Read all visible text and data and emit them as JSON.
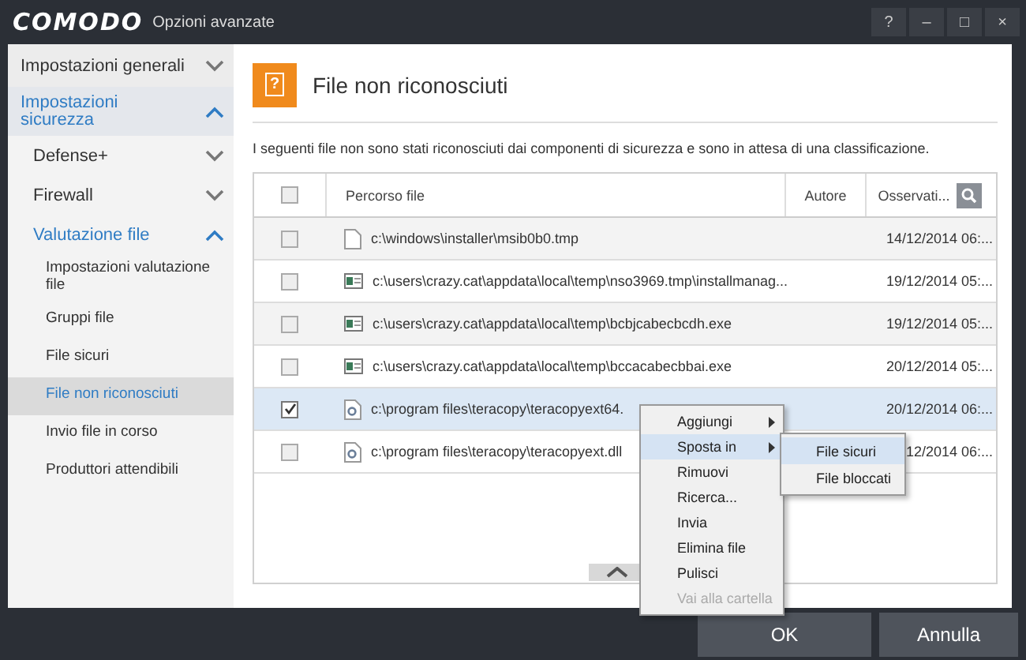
{
  "window": {
    "brand": "COMODO",
    "title": "Opzioni avanzate",
    "controls": [
      "?",
      "–",
      "□",
      "×"
    ]
  },
  "sidebar": {
    "items": [
      {
        "label": "Impostazioni generali",
        "expanded": false
      },
      {
        "label": "Impostazioni sicurezza",
        "expanded": true,
        "children": [
          {
            "label": "Defense+",
            "expanded": false
          },
          {
            "label": "Firewall",
            "expanded": false
          },
          {
            "label": "Valutazione file",
            "expanded": true,
            "children": [
              {
                "label": "Impostazioni valutazione file",
                "selected": false
              },
              {
                "label": "Gruppi file",
                "selected": false
              },
              {
                "label": "File sicuri",
                "selected": false
              },
              {
                "label": "File non riconosciuti",
                "selected": true
              },
              {
                "label": "Invio file in corso",
                "selected": false
              },
              {
                "label": "Produttori attendibili",
                "selected": false
              }
            ]
          }
        ]
      }
    ]
  },
  "header": {
    "icon": "?",
    "title": "File non riconosciuti"
  },
  "description": "I seguenti file non sono stati riconosciuti dai componenti di sicurezza e sono in attesa di una classificazione.",
  "table": {
    "all_checked": false,
    "columns": [
      "Percorso file",
      "Autore",
      "Osservati..."
    ],
    "rows": [
      {
        "kind": "document",
        "checked": false,
        "selected": false,
        "path": "c:\\windows\\installer\\msib0b0.tmp",
        "date": "14/12/2014 06:..."
      },
      {
        "kind": "program",
        "checked": false,
        "selected": false,
        "path": "c:\\users\\crazy.cat\\appdata\\local\\temp\\nso3969.tmp\\installmanag...",
        "date": "19/12/2014 05:..."
      },
      {
        "kind": "program",
        "checked": false,
        "selected": false,
        "path": "c:\\users\\crazy.cat\\appdata\\local\\temp\\bcbjcabecbcdh.exe",
        "date": "19/12/2014 05:..."
      },
      {
        "kind": "program",
        "checked": false,
        "selected": false,
        "path": "c:\\users\\crazy.cat\\appdata\\local\\temp\\bccacabecbbai.exe",
        "date": "20/12/2014 05:..."
      },
      {
        "kind": "library",
        "checked": true,
        "selected": true,
        "path": "c:\\program files\\teracopy\\teracopyext64.",
        "date": "20/12/2014 06:..."
      },
      {
        "kind": "library",
        "checked": false,
        "selected": false,
        "path": "c:\\program files\\teracopy\\teracopyext.dll",
        "date": "12/2014 06:..."
      }
    ]
  },
  "context_menu": {
    "items": [
      {
        "label": "Aggiungi",
        "submenu": true,
        "selected": false,
        "disabled": false
      },
      {
        "label": "Sposta in",
        "submenu": true,
        "selected": true,
        "disabled": false
      },
      {
        "label": "Rimuovi",
        "submenu": false,
        "selected": false,
        "disabled": false
      },
      {
        "label": "Ricerca...",
        "submenu": false,
        "selected": false,
        "disabled": false
      },
      {
        "label": "Invia",
        "submenu": false,
        "selected": false,
        "disabled": false
      },
      {
        "label": "Elimina file",
        "submenu": false,
        "selected": false,
        "disabled": false
      },
      {
        "label": "Pulisci",
        "submenu": false,
        "selected": false,
        "disabled": false
      },
      {
        "label": "Vai alla cartella",
        "submenu": false,
        "selected": false,
        "disabled": true
      }
    ]
  },
  "submenu": {
    "items": [
      {
        "label": "File sicuri",
        "selected": true
      },
      {
        "label": "File bloccati",
        "selected": false
      }
    ]
  },
  "buttons": [
    "OK",
    "Annulla"
  ]
}
